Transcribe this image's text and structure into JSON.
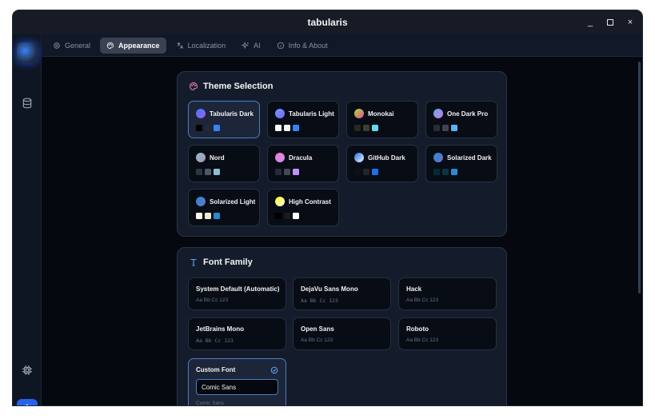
{
  "window": {
    "title": "tabularis",
    "minimize": "_",
    "close": "×"
  },
  "tabs": [
    {
      "label": "General",
      "icon": "gear-icon"
    },
    {
      "label": "Appearance",
      "icon": "palette-icon",
      "active": true
    },
    {
      "label": "Localization",
      "icon": "translate-icon"
    },
    {
      "label": "AI",
      "icon": "sparkles-icon"
    },
    {
      "label": "Info & About",
      "icon": "info-icon"
    }
  ],
  "theme_section": {
    "title": "Theme Selection",
    "themes": [
      {
        "name": "Tabularis Dark",
        "active": true,
        "dot": "linear-gradient(135deg,#3b82f6,#a855f7)",
        "swatches": [
          "#000000",
          "#1f2937",
          "#3b82f6"
        ]
      },
      {
        "name": "Tabularis Light",
        "dot": "linear-gradient(135deg,#60a5fa,#8b5cf6)",
        "swatches": [
          "#ffffff",
          "#f1f5f9",
          "#3b82f6"
        ]
      },
      {
        "name": "Monokai",
        "dot": "linear-gradient(135deg,#a3e635,#ec4899)",
        "swatches": [
          "#272822",
          "#3e3d32",
          "#66d9ef"
        ]
      },
      {
        "name": "One Dark Pro",
        "dot": "linear-gradient(135deg,#61afef,#c678dd)",
        "swatches": [
          "#282c34",
          "#3e4451",
          "#61afef"
        ]
      },
      {
        "name": "Nord",
        "dot": "linear-gradient(135deg,#88c0d0,#b48ead)",
        "swatches": [
          "#2e3440",
          "#4c566a",
          "#88c0d0"
        ]
      },
      {
        "name": "Dracula",
        "dot": "linear-gradient(135deg,#ff79c6,#bd93f9)",
        "swatches": [
          "#282a36",
          "#44475a",
          "#bd93f9"
        ]
      },
      {
        "name": "GitHub Dark",
        "dot": "linear-gradient(135deg,#1f6feb,#f0f6fc)",
        "swatches": [
          "#0d1117",
          "#21262d",
          "#1f6feb"
        ]
      },
      {
        "name": "Solarized Dark",
        "dot": "linear-gradient(135deg,#268bd2,#6c71c4)",
        "swatches": [
          "#002b36",
          "#073642",
          "#268bd2"
        ]
      },
      {
        "name": "Solarized Light",
        "dot": "linear-gradient(135deg,#268bd2,#6c71c4)",
        "swatches": [
          "#fdf6e3",
          "#eee8d5",
          "#268bd2"
        ]
      },
      {
        "name": "High Contrast",
        "dot": "linear-gradient(135deg,#ffff00,#ffffff)",
        "swatches": [
          "#000000",
          "#1a1a1a",
          "#ffffff"
        ]
      }
    ]
  },
  "font_section": {
    "title": "Font Family",
    "fonts": [
      {
        "name": "System Default (Automatic)",
        "preview": "Aa Bb Cc 123"
      },
      {
        "name": "DejaVu Sans Mono",
        "preview": "Aa Bb Cc 123"
      },
      {
        "name": "Hack",
        "preview": "Aa Bb Cc 123"
      },
      {
        "name": "JetBrains Mono",
        "preview": "Aa Bb Cc 123"
      },
      {
        "name": "Open Sans",
        "preview": "Aa Bb Cc 123"
      },
      {
        "name": "Roboto",
        "preview": "Aa Bb Cc 123"
      }
    ],
    "custom": {
      "label": "Custom Font",
      "value": "Comic Sans",
      "preview": "Comic Sans"
    }
  },
  "colors": {
    "accent": "#2563eb",
    "active_border": "#4a7cc8"
  }
}
